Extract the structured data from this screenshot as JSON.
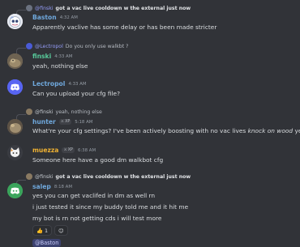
{
  "colors": {
    "background": "#313338",
    "mention_blue": "#949cf7",
    "name_blue": "#6fa8dc",
    "name_green": "#57c99a",
    "name_gold": "#f0b232",
    "name_gray": "#c4c9ce",
    "discord_blurple": "#5865f2"
  },
  "messages": [
    {
      "reply": {
        "mention": "@finski",
        "text": "got a vac live cooldown w the external just now"
      },
      "author": "Baston",
      "time": "4:32 AM",
      "lines": [
        "Apparently vaclive has some delay or has been made stricter"
      ]
    },
    {
      "reply": {
        "mention": "@Lectropol",
        "text": "Do you only use walkbt ?"
      },
      "author": "finski",
      "time": "4:33 AM",
      "lines": [
        "yeah, nothing else"
      ]
    },
    {
      "author": "Lectropol",
      "time": "4:33 AM",
      "lines": [
        "Can you upload your cfg file?"
      ]
    },
    {
      "reply": {
        "mention": "@finski",
        "text": "yeah, nothing else"
      },
      "author": "hunter",
      "tag": "XP",
      "time": "5:18 AM",
      "line_pre": "What're your cfg settings? I've been actively boosting with no vac lives ",
      "line_em": "knock on wood",
      "line_post": " yet"
    },
    {
      "author": "muezza",
      "tag": "XP",
      "time": "6:38 AM",
      "lines": [
        "Someone here have a good dm walkbot cfg"
      ]
    },
    {
      "reply": {
        "mention": "@finski",
        "text": "got a vac live cooldown w the external just now"
      },
      "author": "salep",
      "time": "8:18 AM",
      "lines": [
        "yes you can get vaclifed in dm as well rn",
        "i just tested it since my buddy told me and it hit me",
        "my bot is rn not getting cds i will test more"
      ],
      "reactions": [
        {
          "emoji": "thumbs-up",
          "count": "1"
        }
      ]
    }
  ],
  "mention_pill": "@Baston"
}
